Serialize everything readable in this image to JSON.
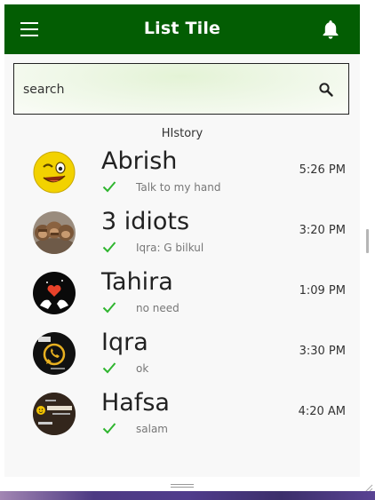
{
  "appbar": {
    "title": "List Tile"
  },
  "search": {
    "placeholder": "search"
  },
  "section": {
    "header": "HIstory"
  },
  "conversations": [
    {
      "name": "Abrish",
      "message": "Talk to my hand",
      "time": "5:26 PM",
      "avatar": "winking-smiley"
    },
    {
      "name": "3 idiots",
      "message": "Iqra: G bilkul",
      "time": "3:20 PM",
      "avatar": "three-monkeys"
    },
    {
      "name": "Tahira",
      "message": "no need",
      "time": "1:09 PM",
      "avatar": "heart-hands"
    },
    {
      "name": "Iqra",
      "message": "ok",
      "time": "3:30 PM",
      "avatar": "whatsapp-dp"
    },
    {
      "name": "Hafsa",
      "message": "salam",
      "time": "4:20 AM",
      "avatar": "my-life-text"
    }
  ],
  "colors": {
    "appbar": "#035d03",
    "check": "#2fb52f",
    "background": "#f8f8f8"
  }
}
